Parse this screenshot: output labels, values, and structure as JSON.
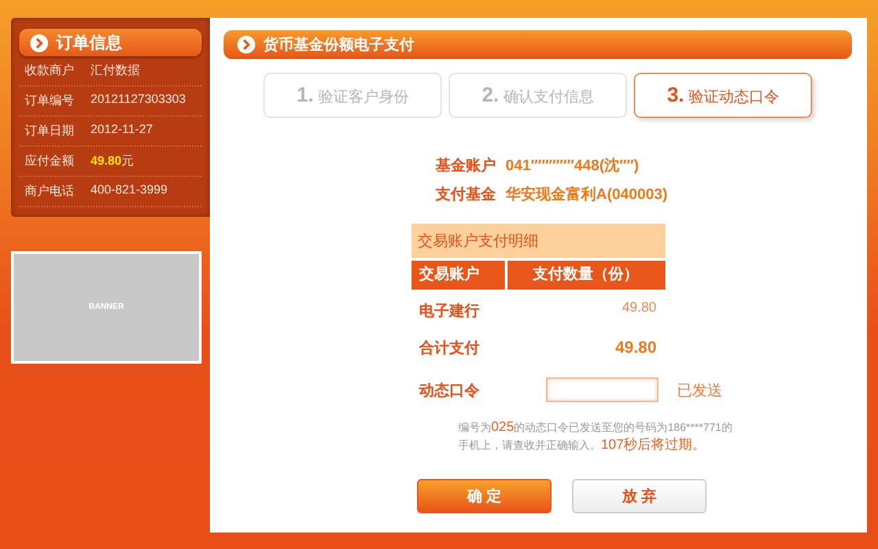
{
  "order_panel": {
    "title": "订单信息",
    "rows": [
      {
        "label": "收款商户",
        "value": "汇付数据",
        "kind": "plain"
      },
      {
        "label": "订单编号",
        "value": "20121127303303",
        "kind": "plain"
      },
      {
        "label": "订单日期",
        "value": "2012-11-27",
        "kind": "plain"
      },
      {
        "label": "应付金额",
        "value": "49.80",
        "unit": "元",
        "kind": "amount"
      },
      {
        "label": "商户电话",
        "value": "400-821-3999",
        "kind": "plain"
      }
    ]
  },
  "banner": {
    "text": "BANNER"
  },
  "main": {
    "title": "货币基金份额电子支付",
    "steps": [
      {
        "number": "1.",
        "label": "验证客户身份",
        "selected": false
      },
      {
        "number": "2.",
        "label": "确认支付信息",
        "selected": false
      },
      {
        "number": "3.",
        "label": "验证动态口令",
        "selected": true
      }
    ],
    "account": [
      {
        "label": "基金账户",
        "value": "041″″″″″″448(沈″″)"
      },
      {
        "label": "支付基金",
        "value": "华安现金富利A(040003)"
      }
    ],
    "table": {
      "caption": "交易账户支付明细",
      "columns": [
        "交易账户",
        "支付数量（份）"
      ],
      "rows": [
        {
          "name": "电子建行",
          "amount": "49.80",
          "kind": "item"
        },
        {
          "name": "合计支付",
          "amount": "49.80",
          "kind": "total"
        }
      ]
    },
    "otp": {
      "label": "动态口令",
      "status": "已发送"
    },
    "note": [
      {
        "text": "编号为",
        "highlight": false
      },
      {
        "text": "025",
        "highlight": true
      },
      {
        "text": "的动态口令已发送至您的号码为186****771的手机上，请查收并正确输入。",
        "highlight": false
      },
      {
        "text": "107秒后将过期。",
        "highlight": true
      }
    ],
    "buttons": [
      {
        "label": "确 定",
        "kind": "primary"
      },
      {
        "label": "放 弃",
        "kind": "secondary"
      }
    ]
  }
}
